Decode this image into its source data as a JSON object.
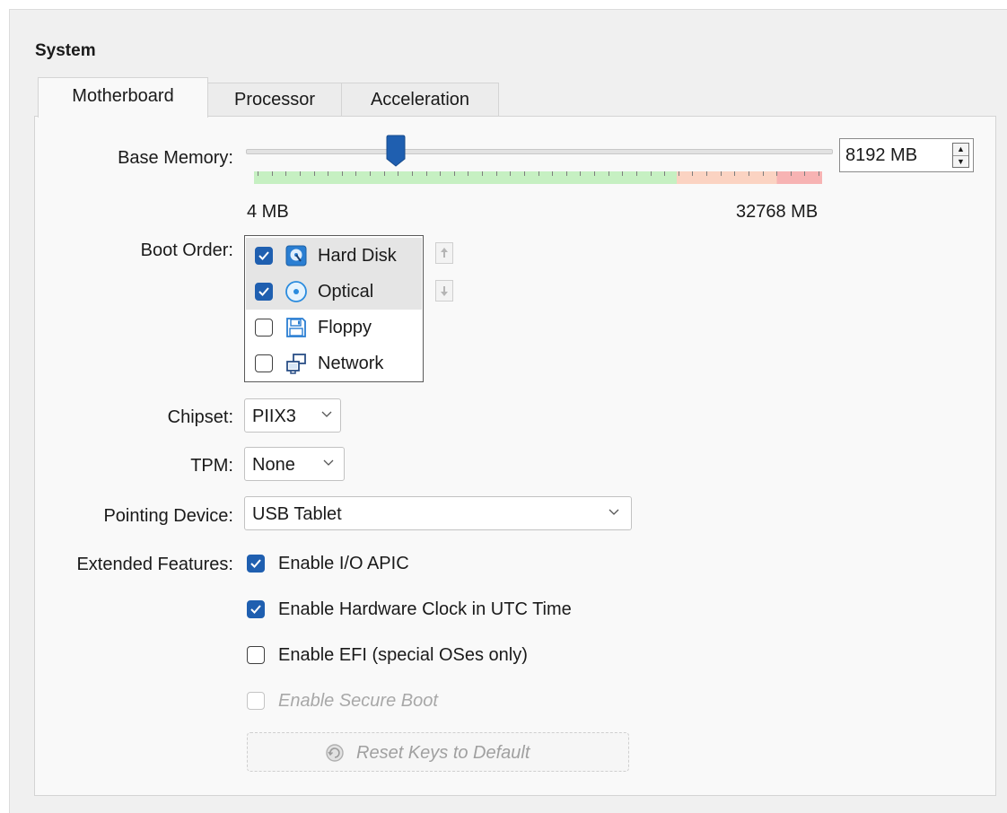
{
  "section": {
    "title": "System"
  },
  "tabs": [
    {
      "label": "Motherboard",
      "active": true
    },
    {
      "label": "Processor",
      "active": false
    },
    {
      "label": "Acceleration",
      "active": false
    }
  ],
  "base_memory": {
    "label": "Base Memory:",
    "value": 8192,
    "value_text": "8192 MB",
    "min_label": "4 MB",
    "max_label": "32768 MB",
    "min": 4,
    "max": 32768
  },
  "boot_order": {
    "label": "Boot Order:",
    "items": [
      {
        "label": "Hard Disk",
        "checked": true,
        "icon": "hard-disk-icon"
      },
      {
        "label": "Optical",
        "checked": true,
        "icon": "optical-disc-icon"
      },
      {
        "label": "Floppy",
        "checked": false,
        "icon": "floppy-icon"
      },
      {
        "label": "Network",
        "checked": false,
        "icon": "network-icon"
      }
    ]
  },
  "chipset": {
    "label": "Chipset:",
    "value": "PIIX3"
  },
  "tpm": {
    "label": "TPM:",
    "value": "None"
  },
  "pointing_device": {
    "label": "Pointing Device:",
    "value": "USB Tablet"
  },
  "extended_features": {
    "label": "Extended Features:",
    "io_apic": {
      "label": "Enable I/O APIC",
      "checked": true
    },
    "utc_clock": {
      "label": "Enable Hardware Clock in UTC Time",
      "checked": true
    },
    "efi": {
      "label": "Enable EFI (special OSes only)",
      "checked": false
    },
    "secure_boot": {
      "label": "Enable Secure Boot",
      "checked": false,
      "enabled": false
    }
  },
  "reset_keys": {
    "label": "Reset Keys to Default",
    "enabled": false
  },
  "colors": {
    "accent": "#1f5fb0",
    "slider_safe": "#c6f0c2",
    "slider_warn": "#fbd3c2",
    "slider_danger": "#f7b3b3"
  }
}
